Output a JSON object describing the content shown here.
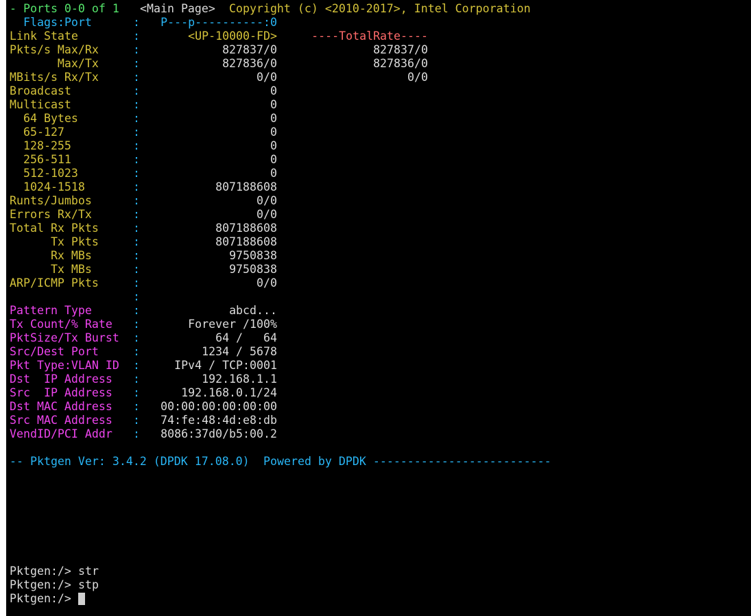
{
  "colors": {
    "background": "#000000",
    "green": "#55e56b",
    "blue": "#29b6f6",
    "yellow": "#d4c23a",
    "white": "#dcdcdc",
    "magenta": "#ee44ee",
    "red": "#ff6a6a"
  },
  "header": {
    "ports": "- Ports 0-0 of 1",
    "page": "<Main Page>",
    "copyright": "Copyright (c) <2010-2017>, Intel Corporation"
  },
  "flags_row": {
    "label": "Flags:Port",
    "colon": ":",
    "value": "P---p----------:0"
  },
  "link_row": {
    "label": "Link State",
    "colon": ":",
    "value": "<UP-10000-FD>",
    "total": "----TotalRate----"
  },
  "stats": [
    {
      "label": "Pkts/s Max/Rx",
      "colon": ":",
      "value": "827837/0",
      "total": "827837/0"
    },
    {
      "label": "       Max/Tx",
      "colon": ":",
      "value": "827836/0",
      "total": "827836/0"
    },
    {
      "label": "MBits/s Rx/Tx",
      "colon": ":",
      "value": "0/0",
      "total": "0/0"
    },
    {
      "label": "Broadcast",
      "colon": ":",
      "value": "0",
      "total": ""
    },
    {
      "label": "Multicast",
      "colon": ":",
      "value": "0",
      "total": ""
    },
    {
      "label": "  64 Bytes",
      "colon": ":",
      "value": "0",
      "total": ""
    },
    {
      "label": "  65-127",
      "colon": ":",
      "value": "0",
      "total": ""
    },
    {
      "label": "  128-255",
      "colon": ":",
      "value": "0",
      "total": ""
    },
    {
      "label": "  256-511",
      "colon": ":",
      "value": "0",
      "total": ""
    },
    {
      "label": "  512-1023",
      "colon": ":",
      "value": "0",
      "total": ""
    },
    {
      "label": "  1024-1518",
      "colon": ":",
      "value": "807188608",
      "total": ""
    },
    {
      "label": "Runts/Jumbos",
      "colon": ":",
      "value": "0/0",
      "total": ""
    },
    {
      "label": "Errors Rx/Tx",
      "colon": ":",
      "value": "0/0",
      "total": ""
    },
    {
      "label": "Total Rx Pkts",
      "colon": ":",
      "value": "807188608",
      "total": ""
    },
    {
      "label": "      Tx Pkts",
      "colon": ":",
      "value": "807188608",
      "total": ""
    },
    {
      "label": "      Rx MBs",
      "colon": ":",
      "value": "9750838",
      "total": ""
    },
    {
      "label": "      Tx MBs",
      "colon": ":",
      "value": "9750838",
      "total": ""
    },
    {
      "label": "ARP/ICMP Pkts",
      "colon": ":",
      "value": "0/0",
      "total": ""
    }
  ],
  "blank_colon": ":",
  "config": [
    {
      "label": "Pattern Type",
      "colon": ":",
      "value": "abcd..."
    },
    {
      "label": "Tx Count/% Rate",
      "colon": ":",
      "value": "Forever /100%"
    },
    {
      "label": "PktSize/Tx Burst",
      "colon": ":",
      "value": "64 /   64"
    },
    {
      "label": "Src/Dest Port",
      "colon": ":",
      "value": "1234 / 5678"
    },
    {
      "label": "Pkt Type:VLAN ID",
      "colon": ":",
      "value": "IPv4 / TCP:0001"
    },
    {
      "label": "Dst  IP Address",
      "colon": ":",
      "value": "192.168.1.1"
    },
    {
      "label": "Src  IP Address",
      "colon": ":",
      "value": "192.168.0.1/24"
    },
    {
      "label": "Dst MAC Address",
      "colon": ":",
      "value": "00:00:00:00:00:00"
    },
    {
      "label": "Src MAC Address",
      "colon": ":",
      "value": "74:fe:48:4d:e8:db"
    },
    {
      "label": "VendID/PCI Addr",
      "colon": ":",
      "value": "8086:37d0/b5:00.2"
    }
  ],
  "footer": {
    "version": "-- Pktgen Ver: 3.4.2 (DPDK 17.08.0)",
    "powered": "Powered by DPDK --------------------------"
  },
  "history": [
    {
      "prompt": "Pktgen:/>",
      "command": "str"
    },
    {
      "prompt": "Pktgen:/>",
      "command": "stp"
    }
  ],
  "current_prompt": {
    "prompt": "Pktgen:/>",
    "command": ""
  }
}
